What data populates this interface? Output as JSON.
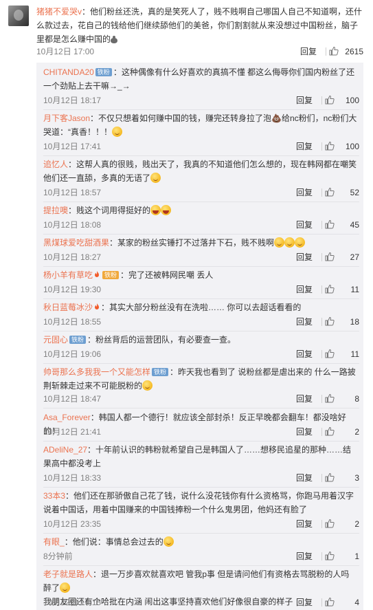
{
  "main_comment": {
    "username": "猪猪不爱哭v",
    "text": "：他们粉丝还洗，真的是笑死人了，贱不贱啊自己哪国人自己不知道啊，还什么款过去，花自己的钱给他们继续舔他们的美爸，你们割割就从来没想过中国粉丝，脑子里都是怎么赚中国的",
    "time": "10月12日 17:00",
    "reply_label": "回复",
    "likes": "2615"
  },
  "replies": [
    {
      "username": "CHITANDA20",
      "badge": "铁粉",
      "text": "：这种偶像有什么好喜欢的真搞不懂 都这么侮辱你们国内粉丝了还一个劲贴上去干嘛→_→",
      "time": "10月12日 18:17",
      "reply_label": "回复",
      "likes": "100"
    },
    {
      "username": "月下客Jason",
      "text": "：不仅只想着如何赚中国的钱，赚完还转身拉了泡💩给nc粉们，nc粉们大哭道：“真香！！！",
      "time": "10月12日 17:41",
      "reply_label": "回复",
      "likes": "100"
    },
    {
      "username": "追忆人",
      "text": "：这帮人真的很贱，贱出天了，我真的不知道他们怎么想的，现在韩网都在嘲笑他们还一直舔，多真的无语了",
      "time": "10月12日 18:57",
      "reply_label": "回复",
      "likes": "52"
    },
    {
      "username": "提拉噢",
      "text": "：贱这个词用得挺好的",
      "time": "10月12日 18:08",
      "reply_label": "回复",
      "likes": "45"
    },
    {
      "username": "黑煤球爱吃甜酒果",
      "text": "：某家的粉丝实锤打不过落井下石，贱不贱啊",
      "time": "10月12日 18:27",
      "reply_label": "回复",
      "likes": "27"
    },
    {
      "username": "杨小羊有草吃",
      "text": "：完了还被韩网民嘲 丢人",
      "time": "10月12日 19:30",
      "reply_label": "回复",
      "likes": "11"
    },
    {
      "username": "秋日蓝莓冰沙",
      "text": "：其实大部分粉丝没有在洗啦…… 你可以去超话看看的",
      "time": "10月12日 18:55",
      "reply_label": "回复",
      "likes": "18"
    },
    {
      "username": "元固心",
      "badge": "铁粉",
      "text": "：粉丝背后的运营团队，有必要查一查。",
      "time": "10月12日 19:06",
      "reply_label": "回复",
      "likes": "11"
    },
    {
      "username": "帅哥那么多我我一个又能怎样",
      "badge": "铁粉",
      "text": "：昨天我也看到了 说粉丝都是虐出来的 什么一路披荆斩棘走过来不可能脱粉的",
      "time": "10月12日 18:47",
      "reply_label": "回复",
      "likes": "8"
    },
    {
      "username": "Asa_Forever",
      "text": "：韩国人都一个德行！就应该全部封杀！反正早晚都会翻车！都没啥好的！",
      "time": "10月12日 21:41",
      "reply_label": "回复",
      "likes": "2"
    },
    {
      "username": "ADeliNe_27",
      "text": "：十年前认识的韩粉就希望自己是韩国人了……想移民追星的那种……结果高中都没考上",
      "time": "10月12日 18:33",
      "reply_label": "回复",
      "likes": "3"
    },
    {
      "username": "33本3",
      "text": "：他们还在那骄傲自己花了钱，说什么没花钱你有什么资格骂，你跑马用着汉字说着中国话，用着中国赚来的中国钱捧粉一个什么鬼男团，他妈还有脸了",
      "time": "10月12日 23:35",
      "reply_label": "回复",
      "likes": "2"
    },
    {
      "username": "有眼_",
      "text": "：他们说：事情总会过去的",
      "time": "8分钟前",
      "reply_label": "回复",
      "likes": "1"
    },
    {
      "username": "老子就是路人",
      "text": "：退一万步喜欢就喜欢吧 管我p事 但是请问他们有资格去骂脱粉的人吗 醉了",
      "text2": "我朋友圈还有个哈批在内涵 闹出这事坚持喜欢他们好像很自豪的样子",
      "time": "10月12日 18:15",
      "reply_label": "回复",
      "likes": "4"
    }
  ],
  "colors": {
    "username": "#eb7350",
    "reply_bg": "#f2f2f5",
    "badge": "#6d9ed0"
  }
}
